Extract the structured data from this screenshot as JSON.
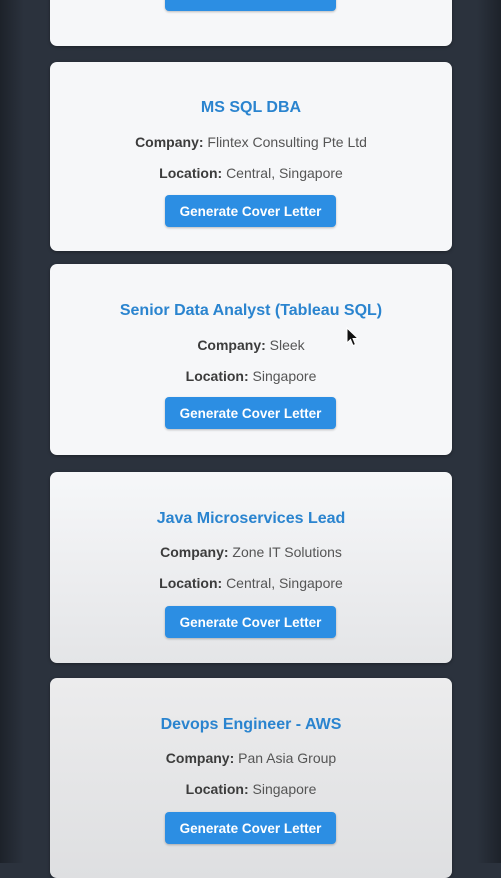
{
  "labels": {
    "company": "Company:",
    "location": "Location:"
  },
  "jobs": [
    {
      "title": "",
      "company": "",
      "location": "",
      "button_label": "Generate Cover Letter"
    },
    {
      "title": "MS SQL DBA",
      "company": "Flintex Consulting Pte Ltd",
      "location": "Central, Singapore",
      "button_label": "Generate Cover Letter"
    },
    {
      "title": "Senior Data Analyst (Tableau SQL)",
      "company": "Sleek",
      "location": "Singapore",
      "button_label": "Generate Cover Letter"
    },
    {
      "title": "Java Microservices Lead",
      "company": "Zone IT Solutions",
      "location": "Central, Singapore",
      "button_label": "Generate Cover Letter"
    },
    {
      "title": "Devops Engineer - AWS",
      "company": "Pan Asia Group",
      "location": "Singapore",
      "button_label": "Generate Cover Letter"
    }
  ],
  "colors": {
    "background": "#2b323d",
    "card": "#f6f7f9",
    "title": "#2a84cf",
    "button": "#2c8ee3"
  },
  "icons": {
    "cursor": "mouse-pointer-icon"
  }
}
